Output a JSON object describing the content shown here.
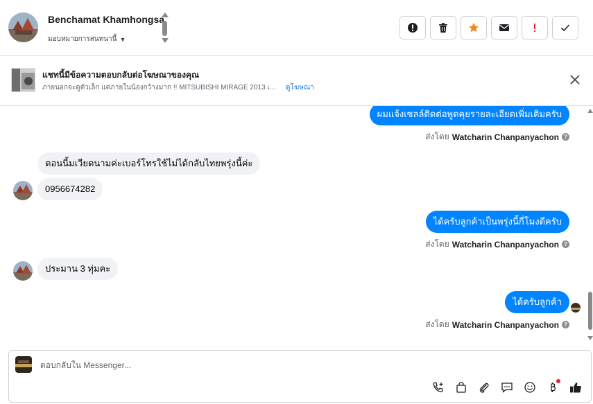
{
  "header": {
    "contact_name": "Benchamat Khamhongsa",
    "assign_label": "มอบหมายการสนทนานี้",
    "actions": [
      {
        "icon": "alert-circle-icon",
        "color": "#1c1e21"
      },
      {
        "icon": "trash-icon",
        "color": "#1c1e21"
      },
      {
        "icon": "star-icon",
        "color": "#f5831f"
      },
      {
        "icon": "envelope-icon",
        "color": "#1c1e21"
      },
      {
        "icon": "exclamation-icon",
        "color": "#e41e3f"
      },
      {
        "icon": "check-icon",
        "color": "#1c1e21"
      }
    ]
  },
  "ad_banner": {
    "title": "แชทนี้มีข้อความตอบกลับต่อโฆษณาของคุณ",
    "subtitle": "ภายนอกจะดูตัวเล็ก แต่ภายในน้องกว้างมาก !! MITSUBISHI MIRAGE 2013 เ...",
    "link": "ดูโฆษณา"
  },
  "messages": [
    {
      "direction": "out",
      "text": "ผมแจ้งเซลล์ติดต่อพูดคุยรายละเอียดเพิ่มเติมครับ",
      "sent_by_label": "ส่งโดย",
      "sender": "Watcharin Chanpanyachon"
    },
    {
      "direction": "in",
      "text": "ตอนนี้มเวียดนามค่ะเบอร์โทรใช้ไม่ได้กลับไทยพรุ่งนี้ค่ะ"
    },
    {
      "direction": "in",
      "text": "0956674282"
    },
    {
      "direction": "out",
      "text": "ได้ครับลูกค้าเป็นพรุ่งนี้กี่โมงดีครับ",
      "sent_by_label": "ส่งโดย",
      "sender": "Watcharin Chanpanyachon"
    },
    {
      "direction": "in",
      "text": "ประมาน 3 ทุ่มคะ"
    },
    {
      "direction": "out",
      "text": "ได้ครับลูกค้า",
      "sent_by_label": "ส่งโดย",
      "sender": "Watcharin Chanpanyachon"
    }
  ],
  "composer": {
    "placeholder": "ตอบกลับใน Messenger...",
    "tools": [
      "call-add-icon",
      "shopping-bag-icon",
      "paperclip-icon",
      "chat-bubble-icon",
      "emoji-icon",
      "baht-icon",
      "thumbs-up-icon"
    ]
  },
  "colors": {
    "outgoing_bubble": "#0084ff",
    "incoming_bubble": "#f0f2f5",
    "link": "#1b74e4"
  }
}
